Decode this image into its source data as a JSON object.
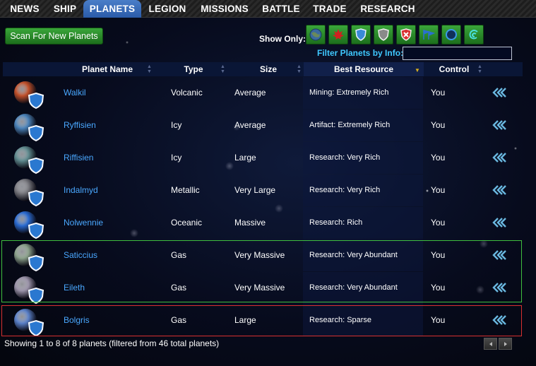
{
  "nav": [
    {
      "label": "NEWS",
      "active": false
    },
    {
      "label": "SHIP",
      "active": false
    },
    {
      "label": "PLANETS",
      "active": true
    },
    {
      "label": "LEGION",
      "active": false
    },
    {
      "label": "MISSIONS",
      "active": false
    },
    {
      "label": "BATTLE",
      "active": false
    },
    {
      "label": "TRADE",
      "active": false
    },
    {
      "label": "RESEARCH",
      "active": false
    }
  ],
  "scan_button": "Scan For New Planets",
  "show_only_label": "Show Only:",
  "filters": [
    {
      "icon": "globe-icon"
    },
    {
      "icon": "maple-leaf-icon"
    },
    {
      "icon": "shield-blue-icon"
    },
    {
      "icon": "shield-gray-icon"
    },
    {
      "icon": "shield-red-x-icon"
    },
    {
      "icon": "flags-icon"
    },
    {
      "icon": "ring-icon"
    },
    {
      "icon": "swirl-icon"
    }
  ],
  "filter_by_info_label": "Filter Planets by Info:",
  "filter_by_info_value": "",
  "columns": [
    "Planet Name",
    "Type",
    "Size",
    "Best Resource",
    "Control"
  ],
  "rows": [
    {
      "name": "Walkil",
      "type": "Volcanic",
      "size": "Average",
      "resource": "Mining: Extremely Rich",
      "control": "You",
      "color": "#c0502a"
    },
    {
      "name": "Ryffisien",
      "type": "Icy",
      "size": "Average",
      "resource": "Artifact: Extremely Rich",
      "control": "You",
      "color": "#4a82b8"
    },
    {
      "name": "Riffisien",
      "type": "Icy",
      "size": "Large",
      "resource": "Research: Very Rich",
      "control": "You",
      "color": "#5f8a8e"
    },
    {
      "name": "Indalmyd",
      "type": "Metallic",
      "size": "Very Large",
      "resource": "Research: Very Rich",
      "control": "You",
      "color": "#7a7a80"
    },
    {
      "name": "Nolwennie",
      "type": "Oceanic",
      "size": "Massive",
      "resource": "Research: Rich",
      "control": "You",
      "color": "#2a6ad0"
    },
    {
      "name": "Saticcius",
      "type": "Gas",
      "size": "Very Massive",
      "resource": "Research: Very Abundant",
      "control": "You",
      "color": "#8aa08a"
    },
    {
      "name": "Eileth",
      "type": "Gas",
      "size": "Very Massive",
      "resource": "Research: Very Abundant",
      "control": "You",
      "color": "#9a92a8"
    },
    {
      "name": "Bolgris",
      "type": "Gas",
      "size": "Large",
      "resource": "Research: Sparse",
      "control": "You",
      "color": "#5a80c8"
    }
  ],
  "footer": "Showing 1 to 8 of 8 planets (filtered from 46 total planets)"
}
